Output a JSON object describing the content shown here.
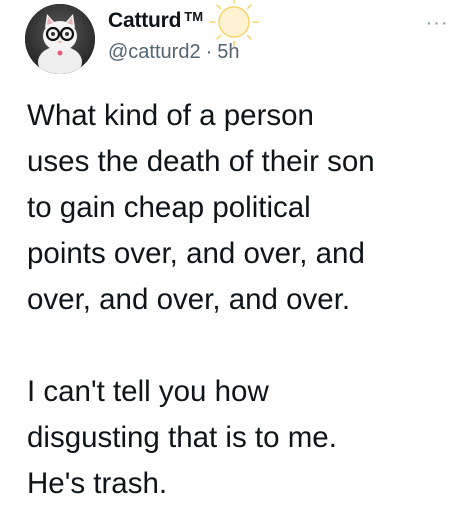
{
  "author": {
    "display_name": "Catturd",
    "trademark": "TM",
    "handle": "@catturd2",
    "separator": "·",
    "time": "5h",
    "avatar_icon": "cat-with-glasses-avatar",
    "name_emoji_icon": "sun-icon"
  },
  "menu": {
    "more_glyph": "···"
  },
  "tweet": {
    "paragraphs": [
      "What kind of a person\nuses the death of their son\nto gain cheap political\npoints over, and over, and\nover, and over, and over.",
      "I can't tell you how\ndisgusting that is to me.\nHe's trash."
    ]
  },
  "colors": {
    "text_primary": "#0f1419",
    "text_secondary": "#536471",
    "sun_emoji": "#f9d36a"
  }
}
